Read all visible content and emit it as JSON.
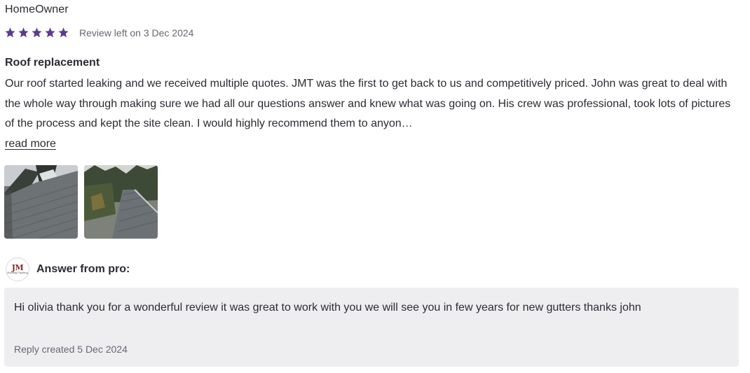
{
  "review": {
    "reviewer_name": "HomeOwner",
    "rating": 5,
    "rating_max": 5,
    "star_color": "#5c3b8e",
    "date_text": "Review left on 3 Dec 2024",
    "title": "Roof replacement",
    "body": "Our roof started leaking and we received multiple quotes. JMT was the first to get back to us and competitively priced. John was great to deal with the whole way through making sure we had all our questions answer and knew what was going on. His crew was professional, took lots of pictures of the process and kept the site clean. I would highly recommend them to anyon…",
    "read_more_label": "read more",
    "photos": [
      {
        "alt": "roof-photo-1"
      },
      {
        "alt": "roof-photo-2"
      }
    ]
  },
  "pro_answer": {
    "logo_text": "JM",
    "logo_subtext": "Roofing Painting",
    "heading": "Answer from pro:",
    "reply_text": "Hi olivia thank you for a wonderful review it was great to work with you we will see you in few years for new gutters thanks john",
    "reply_date": "Reply created 5 Dec 2024"
  }
}
